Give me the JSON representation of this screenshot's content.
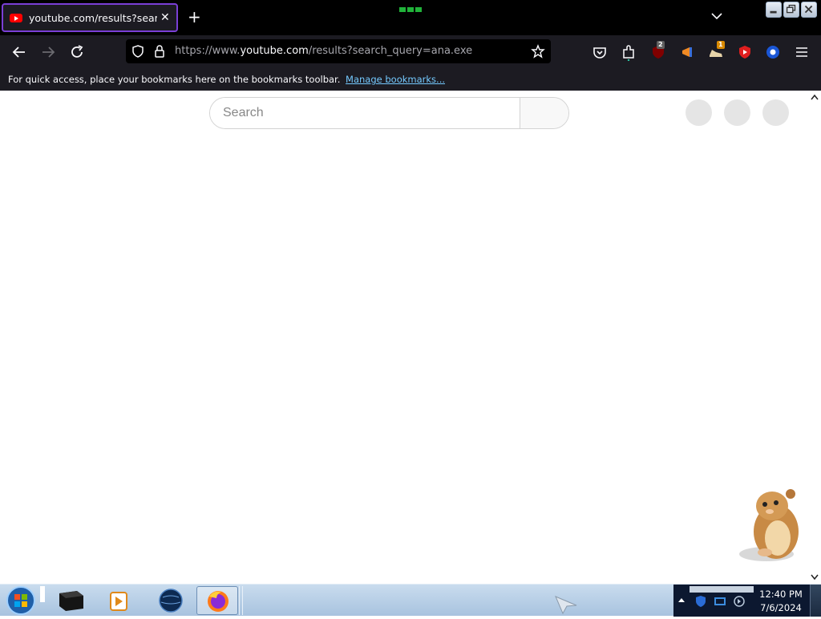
{
  "tab": {
    "title": "youtube.com/results?search_query=ana.exe",
    "close": "✕",
    "new_tab": "+"
  },
  "nav": {
    "url_prefix": "https://www.",
    "url_host": "youtube.com",
    "url_path": "/results?search_query=ana.exe",
    "ublock_count": "2",
    "ext_badge": "1"
  },
  "bookmarks_bar": {
    "message": "For quick access, place your bookmarks here on the bookmarks toolbar.",
    "manage_link": "Manage bookmarks..."
  },
  "youtube": {
    "search_placeholder": "Search"
  },
  "taskbar": {
    "time": "12:40 PM",
    "date": "7/6/2024"
  },
  "colors": {
    "tab_accent": "#7a3fd6",
    "youtube_red": "#ff0000",
    "link": "#75caff",
    "chrome_dark": "#1c1b22"
  }
}
